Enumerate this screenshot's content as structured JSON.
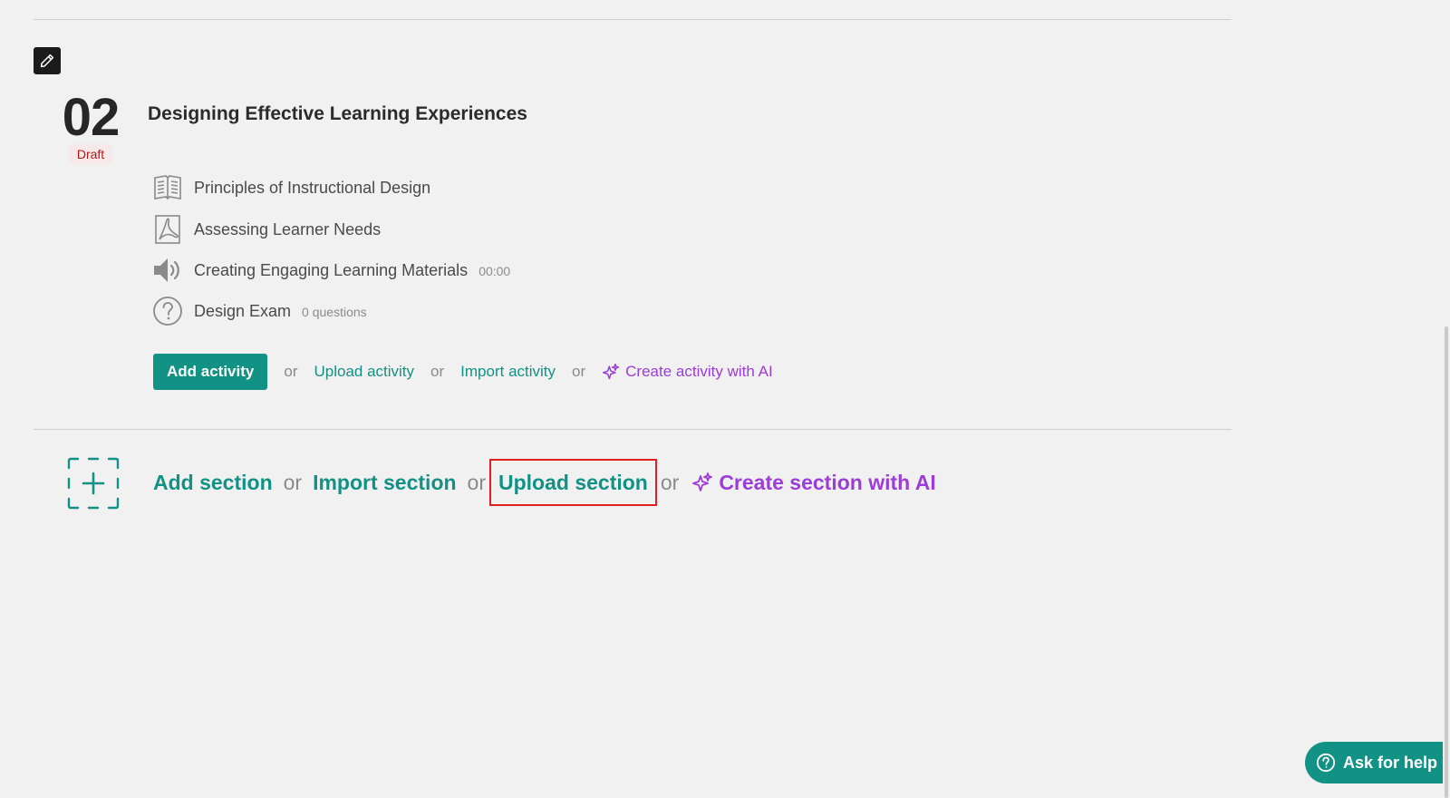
{
  "section": {
    "number": "02",
    "status": "Draft",
    "title": "Designing Effective Learning Experiences",
    "activities": [
      {
        "label": "Principles of Instructional Design",
        "icon": "book-icon",
        "meta": ""
      },
      {
        "label": "Assessing Learner Needs",
        "icon": "pdf-icon",
        "meta": ""
      },
      {
        "label": "Creating Engaging Learning Materials",
        "icon": "audio-icon",
        "meta": "00:00"
      },
      {
        "label": "Design Exam",
        "icon": "question-icon",
        "meta": "0 questions"
      }
    ],
    "actions": {
      "add_activity": "Add activity",
      "or": "or",
      "upload_activity": "Upload activity",
      "import_activity": "Import activity",
      "create_activity_ai": "Create activity with AI"
    }
  },
  "section_actions": {
    "add_section": "Add section",
    "or": "or",
    "import_section": "Import section",
    "upload_section": "Upload section",
    "create_section_ai": "Create section with AI"
  },
  "help": {
    "label": "Ask for help"
  },
  "colors": {
    "accent": "#129185",
    "ai_purple": "#9b3dd6",
    "draft_red": "#b01818",
    "highlight": "#e02020"
  }
}
